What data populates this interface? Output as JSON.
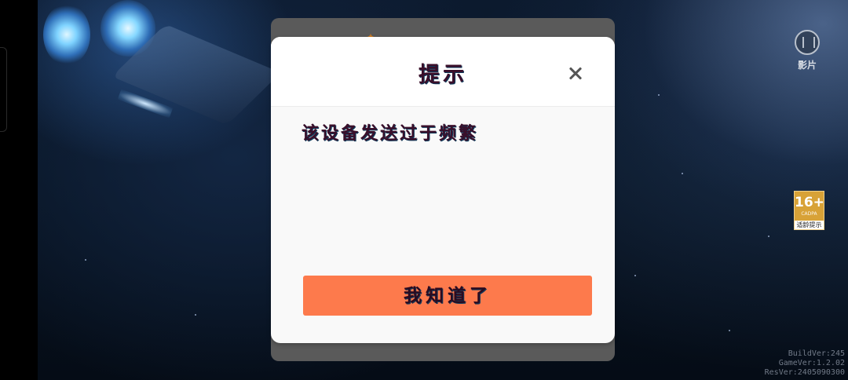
{
  "dialog": {
    "title": "提示",
    "message": "该设备发送过于频繁",
    "confirm_label": "我知道了",
    "close_icon": "close-icon"
  },
  "sidebar": {
    "movie_label": "影片",
    "movie_icon": "film-reel-icon"
  },
  "age_rating": {
    "number": "16+",
    "org": "CADPA",
    "caption": "适龄提示"
  },
  "version": {
    "build": "BuildVer:245",
    "game": "GameVer:1.2.02",
    "res": "ResVer:2405090300"
  },
  "colors": {
    "confirm_button": "#fd7a4c",
    "dialog_bg": "#f9f9f9",
    "back_panel": "#5a5a5a",
    "age_badge": "#d8a237"
  }
}
